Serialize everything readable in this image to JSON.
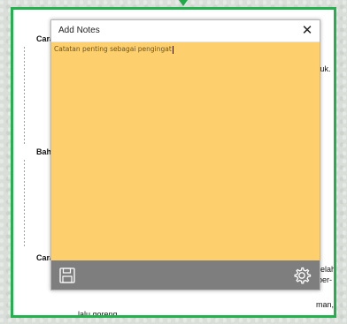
{
  "document": {
    "heading_1": "Cara",
    "heading_2": "Bah",
    "heading_3": "Cara",
    "side_text_1": "ntuk.",
    "side_text_2": "belah",
    "side_text_3": "iber-",
    "side_text_4": "man,",
    "bottom_text": "lalu goreng"
  },
  "notes_window": {
    "title": "Add Notes",
    "close_glyph": "✕",
    "body_text": "Catatan penting sebagai pengingat",
    "toolbar": {
      "save_icon": "save-icon",
      "settings_icon": "gear-icon"
    }
  },
  "colors": {
    "frame_border": "#22b14c",
    "note_background": "#fdcf6d",
    "toolbar_background": "#7e7e7e"
  }
}
